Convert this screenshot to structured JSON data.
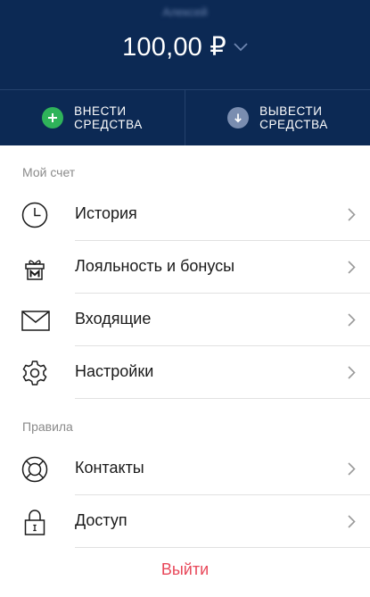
{
  "header": {
    "username": "Алексей",
    "balance": "100,00 ₽"
  },
  "actions": {
    "deposit": {
      "label": "ВНЕСТИ\nСРЕДСТВА",
      "icon": "plus-icon",
      "color": "#2fb35a"
    },
    "withdraw": {
      "label": "ВЫВЕСТИ\nСРЕДСТВА",
      "icon": "arrow-down-icon",
      "color": "#7a8db0"
    }
  },
  "account": {
    "title": "Мой счет",
    "items": [
      {
        "label": "История",
        "icon": "clock-icon"
      },
      {
        "label": "Лояльность и бонусы",
        "icon": "gift-icon"
      },
      {
        "label": "Входящие",
        "icon": "envelope-icon"
      },
      {
        "label": "Настройки",
        "icon": "gear-icon"
      }
    ]
  },
  "rules": {
    "title": "Правила",
    "items": [
      {
        "label": "Контакты",
        "icon": "lifebuoy-icon"
      },
      {
        "label": "Доступ",
        "icon": "lock-icon"
      }
    ]
  },
  "logout": {
    "label": "Выйти",
    "color": "#e8485a"
  },
  "colors": {
    "header_bg": "#0c2954",
    "divider": "#e1e1e1"
  }
}
